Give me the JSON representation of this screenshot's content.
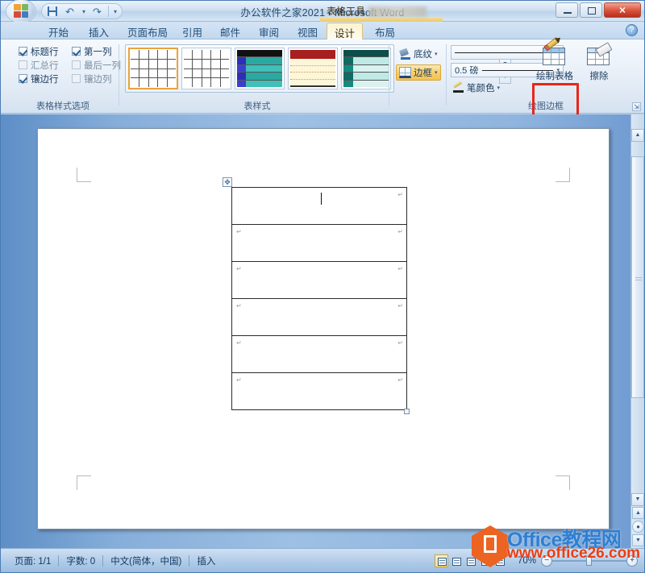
{
  "window": {
    "title": "办公软件之家2021 - Microsoft Word",
    "context_tab_title": "表格工具",
    "minimize_label": "最小化",
    "maximize_label": "最大化",
    "close_label": "✕"
  },
  "quick_access": {
    "save_icon": "save-icon",
    "undo_icon": "undo-icon",
    "redo_icon": "redo-icon",
    "customize_caret": "▾"
  },
  "tabs": [
    {
      "label": "开始",
      "active": false
    },
    {
      "label": "插入",
      "active": false
    },
    {
      "label": "页面布局",
      "active": false
    },
    {
      "label": "引用",
      "active": false
    },
    {
      "label": "邮件",
      "active": false
    },
    {
      "label": "审阅",
      "active": false
    },
    {
      "label": "视图",
      "active": false
    },
    {
      "label": "设计",
      "active": true
    },
    {
      "label": "布局",
      "active": false
    }
  ],
  "help_button": "?",
  "ribbon": {
    "groups": [
      {
        "label": "表格样式选项"
      },
      {
        "label": "表样式"
      },
      {
        "label": "绘图边框"
      }
    ],
    "table_style_options": [
      {
        "label": "标题行",
        "checked": true
      },
      {
        "label": "第一列",
        "checked": true
      },
      {
        "label": "汇总行",
        "checked": false
      },
      {
        "label": "最后一列",
        "checked": false
      },
      {
        "label": "镶边行",
        "checked": true
      },
      {
        "label": "镶边列",
        "checked": false
      }
    ],
    "gallery_nav": {
      "up": "▲",
      "down": "▼",
      "more": "▼"
    },
    "shading_label": "底纹",
    "borders_label": "边框",
    "line_weight_value": "0.5 磅",
    "pen_color_label": "笔颜色",
    "draw_table_label": "绘制表格",
    "eraser_label": "擦除",
    "dropdown_caret": "▾",
    "dialog_launcher": "⇲"
  },
  "document": {
    "table_rows": 6,
    "table_columns": 1,
    "move_handle_icon": "move-handle-icon",
    "resize_handle_icon": "resize-handle-icon",
    "paragraph_mark": "↵"
  },
  "scrollbar": {
    "up_arrow": "▲",
    "down_arrow": "▼",
    "prev_page": "▲",
    "browse_object": "●",
    "next_page": "▼"
  },
  "status_bar": {
    "page_info": "页面: 1/1",
    "word_count": "字数: 0",
    "language": "中文(简体，中国)",
    "insert_mode": "插入",
    "zoom_value": "70%",
    "zoom_minus": "−",
    "zoom_plus": "+",
    "view_buttons": [
      {
        "name": "print-layout-view",
        "active": true
      },
      {
        "name": "full-screen-reading-view",
        "active": false
      },
      {
        "name": "web-layout-view",
        "active": false
      },
      {
        "name": "outline-view",
        "active": false
      },
      {
        "name": "draft-view",
        "active": false
      }
    ]
  },
  "watermark": {
    "site_name": "Office教程网",
    "site_url": "www.office26.com"
  },
  "colors": {
    "accent_orange": "#e8a33d",
    "annotation_red": "#e8251b",
    "title_blue": "#274a6e",
    "watermark_blue": "#2f7fd1",
    "watermark_orange": "#ec6322"
  }
}
